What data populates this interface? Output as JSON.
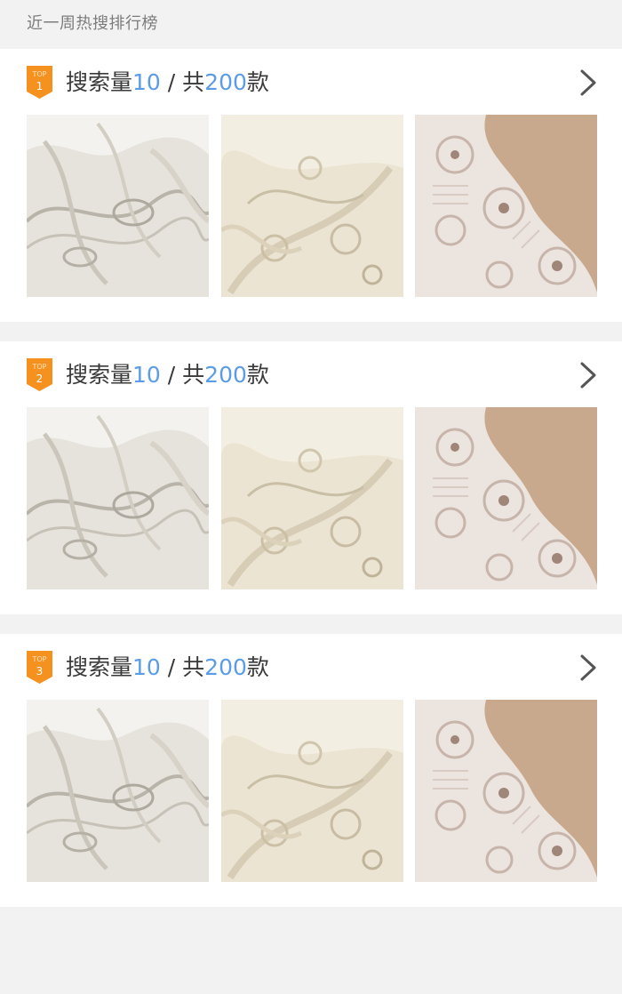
{
  "header": {
    "title": "近一周热搜排行榜"
  },
  "lists": [
    {
      "badge_top": "TOP",
      "rank": "1",
      "prefix": "搜索量",
      "search_count": "10",
      "separator": " / ",
      "total_prefix": "共",
      "total_count": "200",
      "unit": "款",
      "thumbnails": [
        "white-lace-fabric",
        "ivory-lace-fabric",
        "pink-lace-trim"
      ]
    },
    {
      "badge_top": "TOP",
      "rank": "2",
      "prefix": "搜索量",
      "search_count": "10",
      "separator": " / ",
      "total_prefix": "共",
      "total_count": "200",
      "unit": "款",
      "thumbnails": [
        "white-lace-fabric",
        "ivory-lace-fabric",
        "pink-lace-trim"
      ]
    },
    {
      "badge_top": "TOP",
      "rank": "3",
      "prefix": "搜索量",
      "search_count": "10",
      "separator": " / ",
      "total_prefix": "共",
      "total_count": "200",
      "unit": "款",
      "thumbnails": [
        "white-lace-fabric",
        "ivory-lace-fabric",
        "pink-lace-trim"
      ]
    }
  ],
  "colors": {
    "accent": "#5a9ce6",
    "badge": "#f5921f",
    "background": "#f2f2f2",
    "card": "#ffffff",
    "text": "#3a3a3a",
    "muted_text": "#7c7c7c"
  },
  "icons": {
    "rank_badge": "ribbon-icon",
    "more": "chevron-right-icon"
  }
}
